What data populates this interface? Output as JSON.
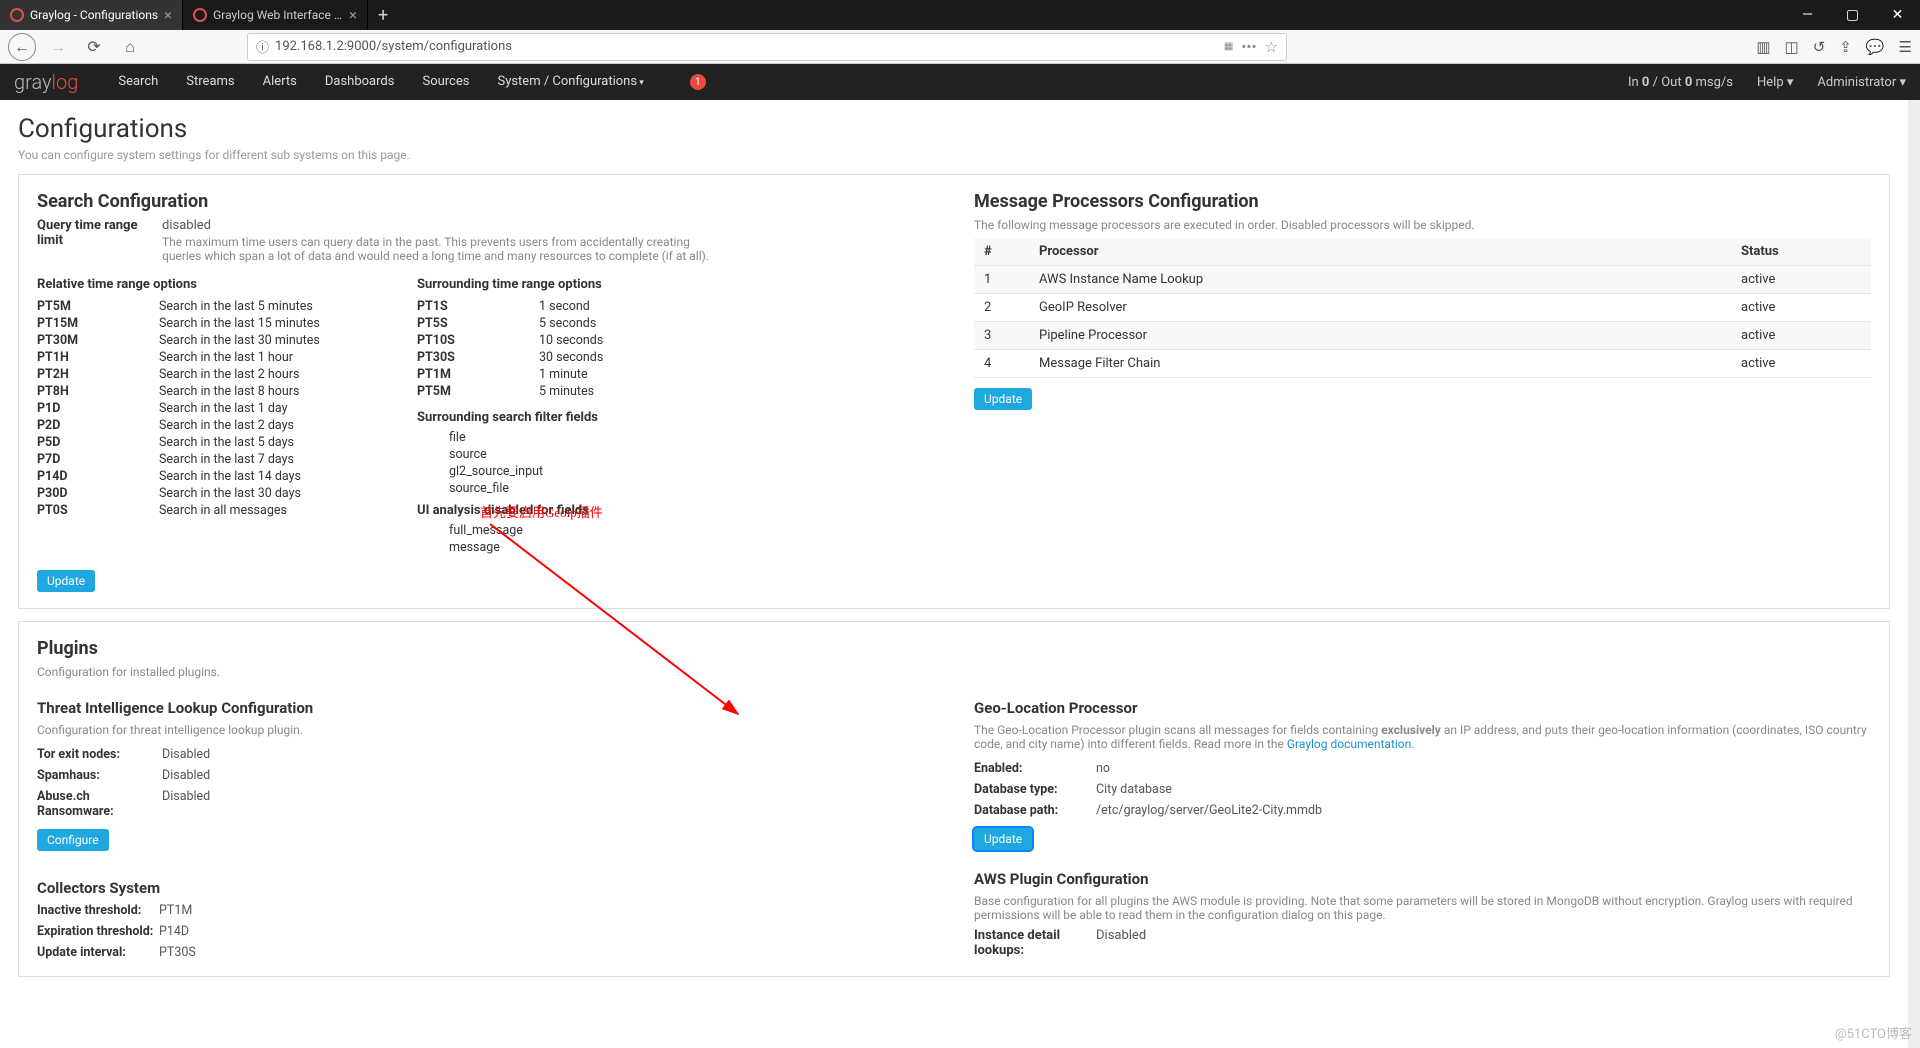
{
  "browser": {
    "tabs": [
      {
        "title": "Graylog - Configurations",
        "active": true
      },
      {
        "title": "Graylog Web Interface - Gra...",
        "active": false
      }
    ],
    "url": "192.168.1.2:9000/system/configurations"
  },
  "navbar": {
    "links": [
      "Search",
      "Streams",
      "Alerts",
      "Dashboards",
      "Sources",
      "System / Configurations"
    ],
    "notif": "1",
    "in_label": "In",
    "in_val": "0",
    "out_label": "Out",
    "out_val": "0",
    "msgs": "msg/s",
    "help": "Help",
    "admin": "Administrator"
  },
  "page": {
    "title": "Configurations",
    "subtitle": "You can configure system settings for different sub systems on this page."
  },
  "search": {
    "title": "Search Configuration",
    "limit_label": "Query time range limit",
    "limit_value": "disabled",
    "limit_desc": "The maximum time users can query data in the past. This prevents users from accidentally creating queries which span a lot of data and would need a long time and many resources to complete (if at all).",
    "relative_title": "Relative time range options",
    "relative": [
      {
        "code": "PT5M",
        "label": "Search in the last 5 minutes"
      },
      {
        "code": "PT15M",
        "label": "Search in the last 15 minutes"
      },
      {
        "code": "PT30M",
        "label": "Search in the last 30 minutes"
      },
      {
        "code": "PT1H",
        "label": "Search in the last 1 hour"
      },
      {
        "code": "PT2H",
        "label": "Search in the last 2 hours"
      },
      {
        "code": "PT8H",
        "label": "Search in the last 8 hours"
      },
      {
        "code": "P1D",
        "label": "Search in the last 1 day"
      },
      {
        "code": "P2D",
        "label": "Search in the last 2 days"
      },
      {
        "code": "P5D",
        "label": "Search in the last 5 days"
      },
      {
        "code": "P7D",
        "label": "Search in the last 7 days"
      },
      {
        "code": "P14D",
        "label": "Search in the last 14 days"
      },
      {
        "code": "P30D",
        "label": "Search in the last 30 days"
      },
      {
        "code": "PT0S",
        "label": "Search in all messages"
      }
    ],
    "surround_title": "Surrounding time range options",
    "surround": [
      {
        "code": "PT1S",
        "label": "1 second"
      },
      {
        "code": "PT5S",
        "label": "5 seconds"
      },
      {
        "code": "PT10S",
        "label": "10 seconds"
      },
      {
        "code": "PT30S",
        "label": "30 seconds"
      },
      {
        "code": "PT1M",
        "label": "1 minute"
      },
      {
        "code": "PT5M",
        "label": "5 minutes"
      }
    ],
    "filter_title": "Surrounding search filter fields",
    "filter_fields": [
      "file",
      "source",
      "gl2_source_input",
      "source_file"
    ],
    "disabled_title": "UI analysis disabled for fields",
    "disabled_fields": [
      "full_message",
      "message"
    ],
    "update": "Update"
  },
  "processors": {
    "title": "Message Processors Configuration",
    "sub": "The following message processors are executed in order. Disabled processors will be skipped.",
    "head": {
      "n": "#",
      "p": "Processor",
      "s": "Status"
    },
    "rows": [
      {
        "n": "1",
        "p": "AWS Instance Name Lookup",
        "s": "active"
      },
      {
        "n": "2",
        "p": "GeoIP Resolver",
        "s": "active"
      },
      {
        "n": "3",
        "p": "Pipeline Processor",
        "s": "active"
      },
      {
        "n": "4",
        "p": "Message Filter Chain",
        "s": "active"
      }
    ],
    "update": "Update"
  },
  "plugins": {
    "title": "Plugins",
    "sub": "Configuration for installed plugins.",
    "threat": {
      "title": "Threat Intelligence Lookup Configuration",
      "sub": "Configuration for threat intelligence lookup plugin.",
      "rows": [
        {
          "k": "Tor exit nodes:",
          "v": "Disabled"
        },
        {
          "k": "Spamhaus:",
          "v": "Disabled"
        },
        {
          "k": "Abuse.ch Ransomware:",
          "v": "Disabled"
        }
      ],
      "configure": "Configure"
    },
    "geo": {
      "title": "Geo-Location Processor",
      "desc_a": "The Geo-Location Processor plugin scans all messages for fields containing ",
      "desc_b": "exclusively",
      "desc_c": " an IP address, and puts their geo-location information (coordinates, ISO country code, and city name) into different fields. Read more in the ",
      "link": "Graylog documentation",
      "rows": [
        {
          "k": "Enabled:",
          "v": "no"
        },
        {
          "k": "Database type:",
          "v": "City database"
        },
        {
          "k": "Database path:",
          "v": "/etc/graylog/server/GeoLite2-City.mmdb"
        }
      ],
      "update": "Update"
    },
    "collectors": {
      "title": "Collectors System",
      "rows": [
        {
          "k": "Inactive threshold:",
          "v": "PT1M"
        },
        {
          "k": "Expiration threshold:",
          "v": "P14D"
        },
        {
          "k": "Update interval:",
          "v": "PT30S"
        }
      ]
    },
    "aws": {
      "title": "AWS Plugin Configuration",
      "desc": "Base configuration for all plugins the AWS module is providing. Note that some parameters will be stored in MongoDB without encryption. Graylog users with required permissions will be able to read them in the configuration dialog on this page.",
      "row": {
        "k": "Instance detail lookups:",
        "v": "Disabled"
      }
    }
  },
  "annotation": "首先要启用Geoip插件",
  "watermark": "@51CTO博客"
}
